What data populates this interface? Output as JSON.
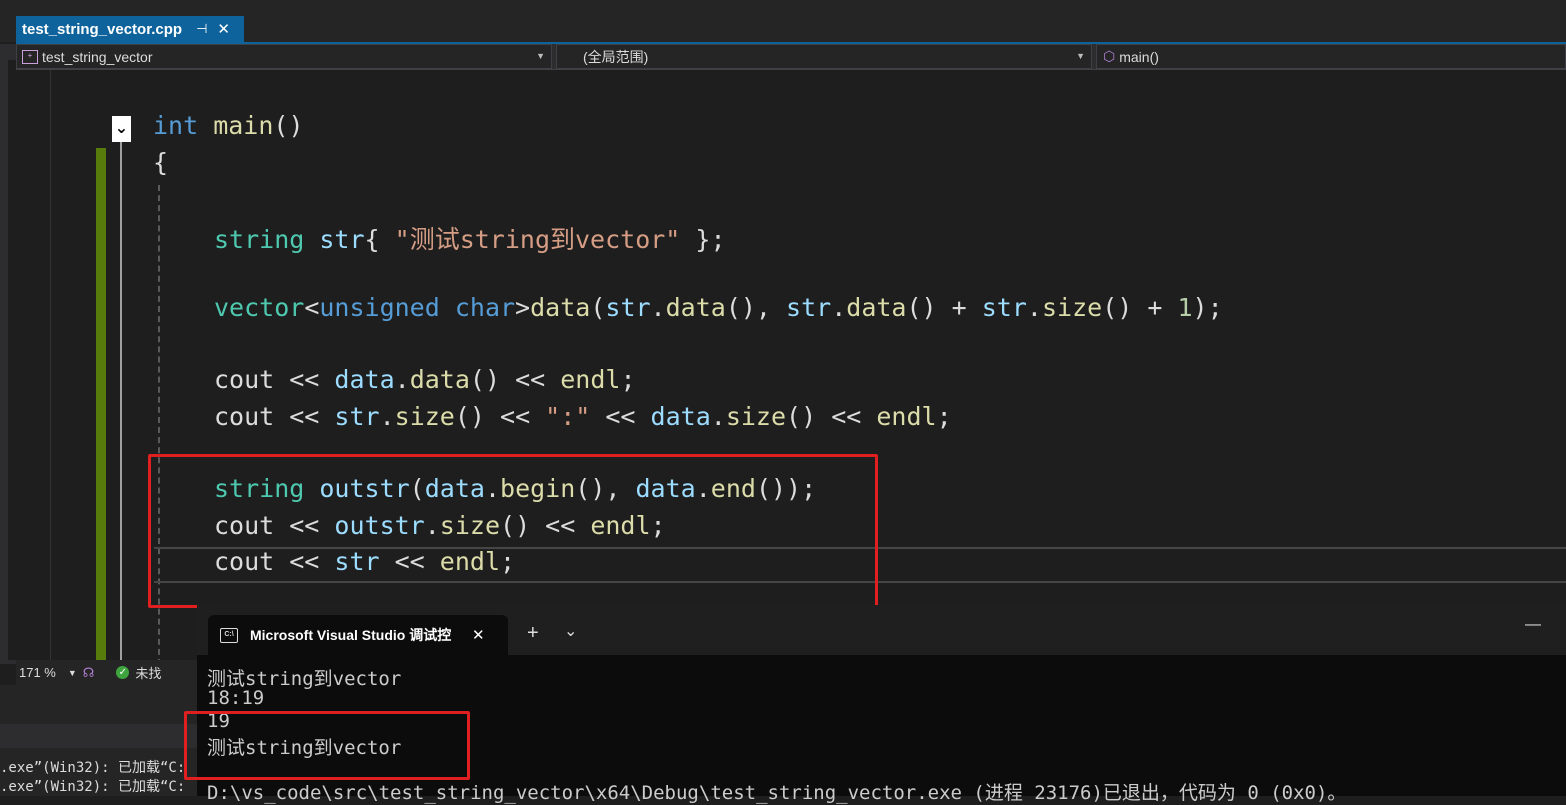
{
  "tab": {
    "filename": "test_string_vector.cpp",
    "pin_icon": "⊣",
    "close_icon": "✕"
  },
  "navbar": {
    "project": "test_string_vector",
    "scope": "(全局范围)",
    "member": "main()"
  },
  "code": {
    "l1_kw": "int",
    "l1_fn": " main",
    "l1_rest": "()",
    "l2": "{",
    "l3_ty": "string",
    "l3_vr": " str",
    "l3_p1": "{ ",
    "l3_st": "\"测试string到vector\"",
    "l3_p2": " };",
    "l4_ty": "vector",
    "l4_p1": "<",
    "l4_kw": "unsigned char",
    "l4_p2": ">",
    "l4_fn": "data",
    "l4_p3": "(",
    "l4_vr1": "str",
    "l4_p4": ".",
    "l4_fn2": "data",
    "l4_p5": "(), ",
    "l4_vr2": "str",
    "l4_p6": ".",
    "l4_fn3": "data",
    "l4_p7": "() + ",
    "l4_vr3": "str",
    "l4_p8": ".",
    "l4_fn4": "size",
    "l4_p9": "() + ",
    "l4_nm": "1",
    "l4_p10": ");",
    "l5_a": "cout << ",
    "l5_vr": "data",
    "l5_b": ".",
    "l5_fn": "data",
    "l5_c": "() << ",
    "l5_fn2": "endl",
    "l5_d": ";",
    "l6_a": "cout << ",
    "l6_vr": "str",
    "l6_b": ".",
    "l6_fn": "size",
    "l6_c": "() << ",
    "l6_st": "\":\"",
    "l6_d": " << ",
    "l6_vr2": "data",
    "l6_e": ".",
    "l6_fn2": "size",
    "l6_f": "() << ",
    "l6_fn3": "endl",
    "l6_g": ";",
    "l7_ty": "string",
    "l7_fn": " outstr",
    "l7_a": "(",
    "l7_vr": "data",
    "l7_b": ".",
    "l7_fn2": "begin",
    "l7_c": "(), ",
    "l7_vr2": "data",
    "l7_d": ".",
    "l7_fn3": "end",
    "l7_e": "());",
    "l8_a": "cout << ",
    "l8_vr": "outstr",
    "l8_b": ".",
    "l8_fn": "size",
    "l8_c": "() << ",
    "l8_fn2": "endl",
    "l8_d": ";",
    "l9_a": "cout << ",
    "l9_vr": "str",
    "l9_b": " << ",
    "l9_fn": "endl",
    "l9_c": ";"
  },
  "status": {
    "zoom": "171 %",
    "message": "未找"
  },
  "output": {
    "line1": ".exe”(Win32): 已加载“C:",
    "line2": ".exe”(Win32): 已加载“C:"
  },
  "terminal": {
    "tab_title": "Microsoft Visual Studio 调试控",
    "lines": [
      "测试string到vector",
      "18:19",
      "19",
      "测试string到vector"
    ],
    "exit_line": "D:\\vs_code\\src\\test_string_vector\\x64\\Debug\\test_string_vector.exe (进程 23176)已退出，代码为 0 (0x0)。",
    "new_tab": "+",
    "dropdown": "⌄",
    "minimize": "—",
    "close": "✕"
  },
  "colors": {
    "accent": "#0e639c",
    "change_bar": "#587c0c",
    "highlight": "#e02020"
  }
}
